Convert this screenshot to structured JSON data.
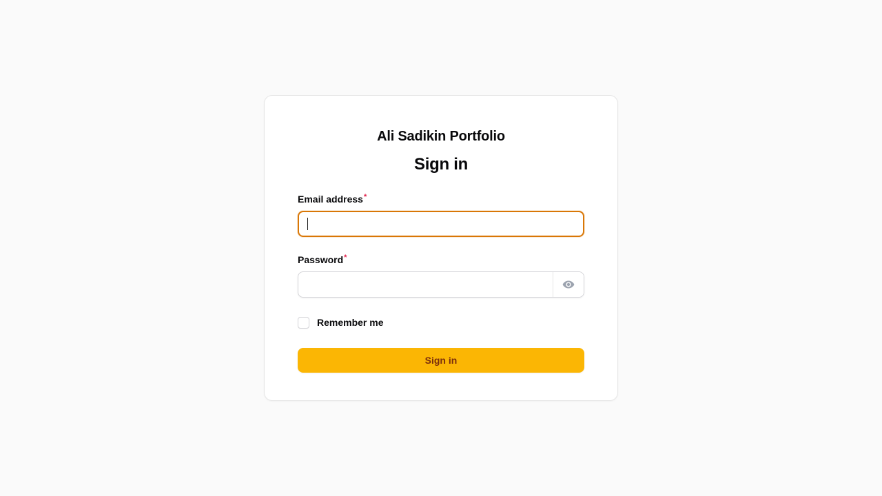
{
  "brand": {
    "name": "Ali Sadikin Portfolio"
  },
  "form": {
    "heading": "Sign in",
    "email": {
      "label": "Email address",
      "required_mark": "*",
      "value": "",
      "placeholder": ""
    },
    "password": {
      "label": "Password",
      "required_mark": "*",
      "value": "",
      "placeholder": "",
      "toggle_icon": "eye-icon"
    },
    "remember": {
      "label": "Remember me",
      "checked": false
    },
    "submit_label": "Sign in"
  },
  "colors": {
    "accent": "#fbb604",
    "accent_text": "#7a2e0e",
    "focus_ring": "#d97706",
    "required": "#e11d48",
    "background": "#fafafa"
  }
}
